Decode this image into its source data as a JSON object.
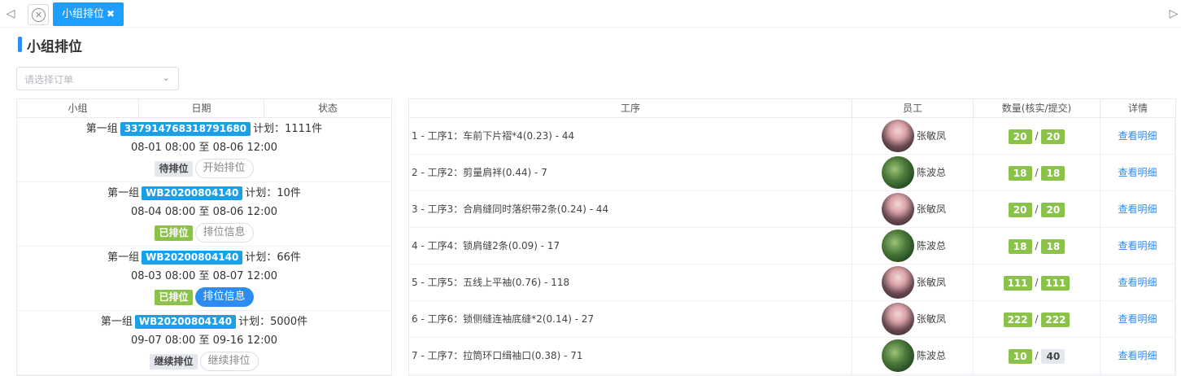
{
  "tabs": {
    "nav_left": "◁",
    "nav_right": "▷",
    "close_icon": "✕",
    "active_label": "小组排位",
    "active_close": "✖"
  },
  "page": {
    "title": "小组排位"
  },
  "order_select": {
    "placeholder": "请选择订单",
    "chevron": "⌄"
  },
  "left_table": {
    "headers": [
      "小组",
      "日期",
      "状态"
    ],
    "rows": [
      {
        "group": "第一组",
        "order_no": "337914768318791680",
        "plan": "计划：1111件",
        "date": "08-01 08:00 至 08-06 12:00",
        "status": "待排位",
        "status_color": "grey",
        "action": "开始排位",
        "action_primary": false
      },
      {
        "group": "第一组",
        "order_no": "WB20200804140",
        "plan": "计划：10件",
        "date": "08-04 08:00 至 08-06 12:00",
        "status": "已排位",
        "status_color": "green",
        "action": "排位信息",
        "action_primary": false
      },
      {
        "group": "第一组",
        "order_no": "WB20200804140",
        "plan": "计划：66件",
        "date": "08-03 08:00 至 08-07 12:00",
        "status": "已排位",
        "status_color": "green",
        "action": "排位信息",
        "action_primary": true
      },
      {
        "group": "第一组",
        "order_no": "WB20200804140",
        "plan": "计划：5000件",
        "date": "09-07 08:00 至 09-16 12:00",
        "status": "继续排位",
        "status_color": "grey",
        "action": "继续排位",
        "action_primary": false
      }
    ]
  },
  "right_table": {
    "headers": [
      "工序",
      "员工",
      "数量(核实/提交)",
      "详情"
    ],
    "rows": [
      {
        "process": "1 - 工序1：车前下片褶*4(0.23) - 44",
        "employee": "张敏凤",
        "avatar": "a",
        "verified": "20",
        "submitted": "20",
        "submitted_color": "green",
        "detail": "查看明细"
      },
      {
        "process": "2 - 工序2：剪量肩袢(0.44) - 7",
        "employee": "陈波总",
        "avatar": "b",
        "verified": "18",
        "submitted": "18",
        "submitted_color": "green",
        "detail": "查看明细"
      },
      {
        "process": "3 - 工序3：合肩缝同时落织带2条(0.24) - 44",
        "employee": "张敏凤",
        "avatar": "a",
        "verified": "20",
        "submitted": "20",
        "submitted_color": "green",
        "detail": "查看明细"
      },
      {
        "process": "4 - 工序4：锁肩缝2条(0.09) - 17",
        "employee": "陈波总",
        "avatar": "b",
        "verified": "18",
        "submitted": "18",
        "submitted_color": "green",
        "detail": "查看明细"
      },
      {
        "process": "5 - 工序5：五线上平袖(0.76) - 118",
        "employee": "张敏凤",
        "avatar": "a",
        "verified": "111",
        "submitted": "111",
        "submitted_color": "green",
        "detail": "查看明细"
      },
      {
        "process": "6 - 工序6：锁侧缝连袖底缝*2(0.14) - 27",
        "employee": "张敏凤",
        "avatar": "a",
        "verified": "222",
        "submitted": "222",
        "submitted_color": "green",
        "detail": "查看明细"
      },
      {
        "process": "7 - 工序7：拉筒环口缉袖口(0.38) - 71",
        "employee": "陈波总",
        "avatar": "b",
        "verified": "10",
        "submitted": "40",
        "submitted_color": "grey",
        "detail": "查看明细"
      }
    ],
    "qty_separator": "/"
  },
  "colors": {
    "primary": "#2d8cf0",
    "tab_blue": "#1e9fff",
    "order_tag": "#1aa0e8",
    "green_tag": "#8bc34a",
    "grey_tag": "#e4e7ed"
  }
}
